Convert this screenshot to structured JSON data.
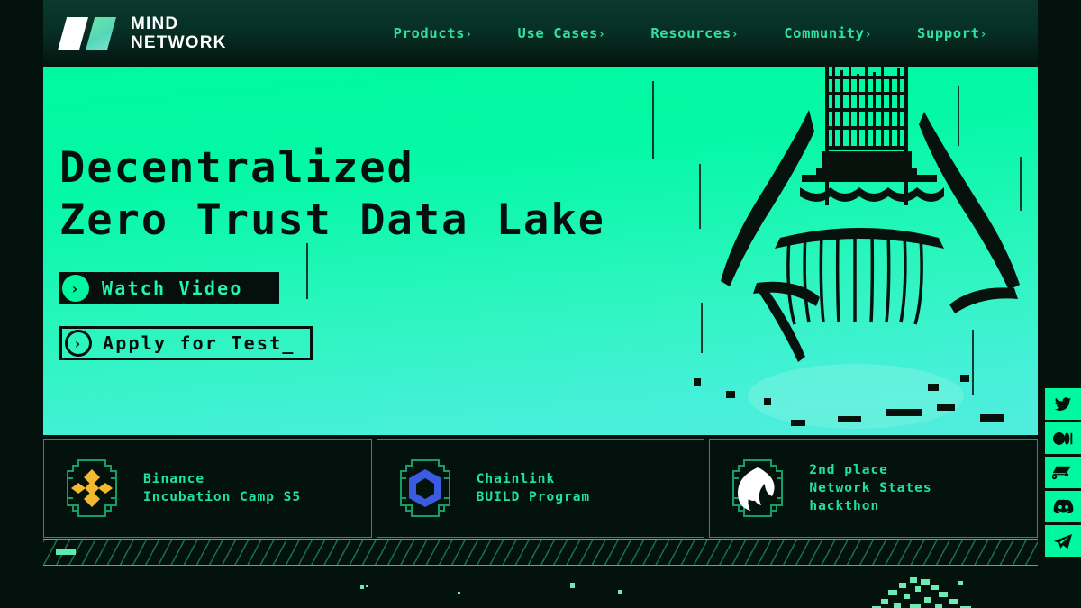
{
  "brand": {
    "name_line1": "MIND",
    "name_line2": "NETWORK",
    "logo_icon": "mind-network-logo",
    "accent": "#00f9a0",
    "dark": "#04120e"
  },
  "nav": {
    "items": [
      {
        "label": "Products",
        "chevron": "›"
      },
      {
        "label": "Use Cases",
        "chevron": "›"
      },
      {
        "label": "Resources",
        "chevron": "›"
      },
      {
        "label": "Community",
        "chevron": "›"
      },
      {
        "label": "Support",
        "chevron": "›"
      }
    ]
  },
  "hero": {
    "headline_line1": "Decentralized",
    "headline_line2": "Zero Trust Data Lake",
    "buttons": [
      {
        "label": "Watch Video",
        "icon": "play-chevron-icon",
        "style": "primary"
      },
      {
        "label": "Apply for Test_",
        "icon": "play-chevron-icon",
        "style": "outline"
      }
    ],
    "artwork": "rocket-launch-illustration",
    "bg_top": "#00f9a0",
    "bg_bottom": "#52ecde"
  },
  "cards": [
    {
      "icon": "binance-logo-icon",
      "icon_color": "#f3ba2f",
      "line1": "Binance",
      "line2": "Incubation Camp S5",
      "line3": ""
    },
    {
      "icon": "chainlink-logo-icon",
      "icon_color": "#3b5ce0",
      "line1": "Chainlink",
      "line2": "BUILD Program",
      "line3": ""
    },
    {
      "icon": "flame-badge-icon",
      "icon_color": "#ffffff",
      "line1": "2nd place",
      "line2": "Network States",
      "line3": "hackthon"
    }
  ],
  "social": {
    "items": [
      {
        "icon": "twitter-icon",
        "name": "Twitter"
      },
      {
        "icon": "medium-icon",
        "name": "Medium"
      },
      {
        "icon": "mirror-icon",
        "name": "Mirror"
      },
      {
        "icon": "discord-icon",
        "name": "Discord"
      },
      {
        "icon": "telegram-icon",
        "name": "Telegram"
      }
    ]
  }
}
